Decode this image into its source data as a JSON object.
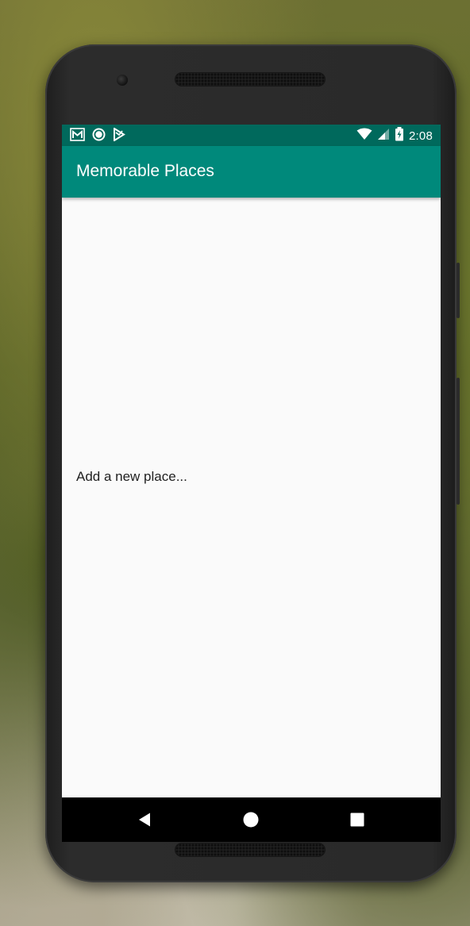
{
  "status_bar": {
    "time": "2:08",
    "icons_left": [
      "gmail-icon",
      "circle-sync-icon",
      "play-store-icon"
    ],
    "icons_right": [
      "wifi-icon",
      "cell-signal-icon",
      "battery-charging-icon"
    ],
    "color": "#00695c"
  },
  "app_bar": {
    "title": "Memorable Places",
    "color": "#00897b"
  },
  "places_list": {
    "items": [
      {
        "label": "Add a new place..."
      }
    ]
  },
  "nav_bar": {
    "buttons": [
      "back-icon",
      "home-icon",
      "recents-icon"
    ]
  }
}
